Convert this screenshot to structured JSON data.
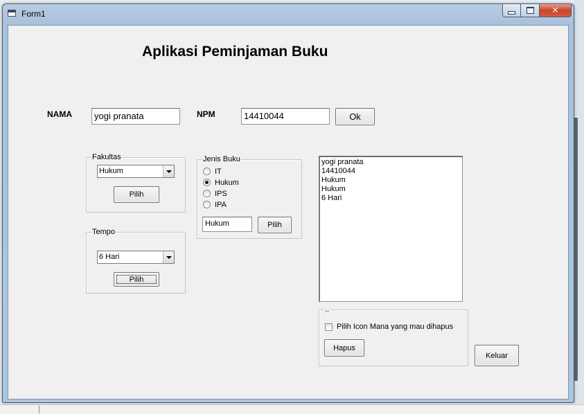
{
  "window": {
    "title": "Form1",
    "close_glyph": "✕"
  },
  "app_title": "Aplikasi Peminjaman Buku",
  "nama": {
    "label": "NAMA",
    "value": "yogi pranata"
  },
  "npm": {
    "label": "NPM",
    "value": "14410044"
  },
  "ok_button": "Ok",
  "fakultas": {
    "legend": "Fakultas",
    "selected": "Hukum",
    "button": "Pilih"
  },
  "tempo": {
    "legend": "Tempo",
    "selected": "6 Hari",
    "button": "Pilih"
  },
  "jenis_buku": {
    "legend": "Jenis Buku",
    "options": [
      {
        "label": "IT",
        "checked": false
      },
      {
        "label": "Hukum",
        "checked": true
      },
      {
        "label": "IPS",
        "checked": false
      },
      {
        "label": "IPA",
        "checked": false
      }
    ],
    "value": "Hukum",
    "button": "Pilih"
  },
  "output_list": [
    "yogi pranata",
    "14410044",
    "Hukum",
    "Hukum",
    "6 Hari"
  ],
  "hapus_frame": {
    "legend": "..",
    "checkbox_label": "Pilih Icon Mana yang mau dihapus",
    "checked": false,
    "button": "Hapus"
  },
  "keluar_button": "Keluar",
  "icons": [
    "app-form-icon",
    "minimize-icon",
    "maximize-icon",
    "close-icon",
    "dropdown-arrow-icon"
  ]
}
